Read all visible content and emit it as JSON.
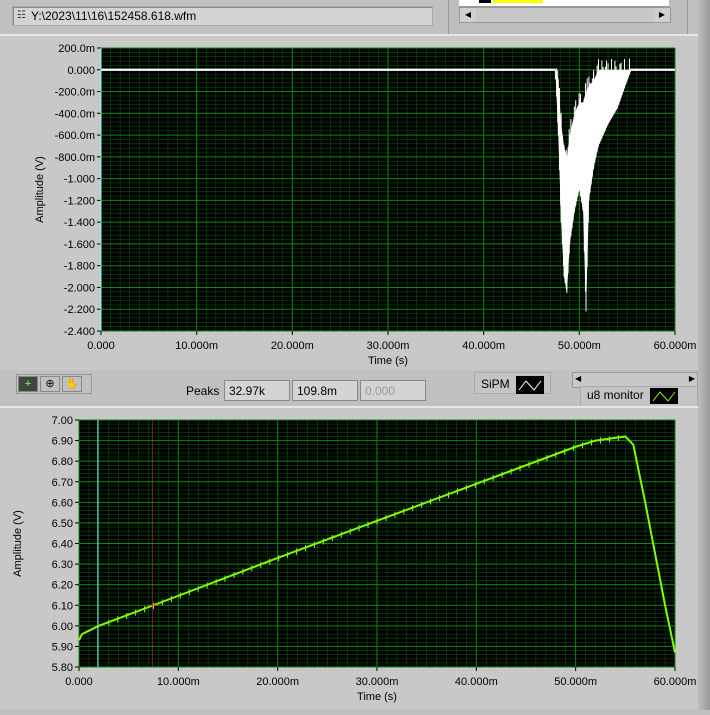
{
  "header": {
    "file_path": "Y:\\2023\\11\\16\\152458.618.wfm"
  },
  "toolbar": {
    "tools": [
      "cursor-tool",
      "zoom-tool",
      "pan-tool"
    ]
  },
  "peaks": {
    "label": "Peaks",
    "values": [
      "32.97k",
      "109.8m",
      "0.000"
    ]
  },
  "legends": {
    "sipm": "SiPM",
    "u8": "u8 monitor"
  },
  "colors": {
    "plot_bg": "#000000",
    "grid": "#0a8a0a",
    "top_trace": "#ffffff",
    "bottom_trace": "#7fff00",
    "cursor1": "#80ffff",
    "cursor2": "#ff3030"
  },
  "chart_data": [
    {
      "type": "line",
      "name": "SiPM",
      "xlabel": "Time (s)",
      "ylabel": "Amplitude (V)",
      "xlim": [
        0,
        0.06
      ],
      "ylim": [
        -2.4,
        0.2
      ],
      "xticks": [
        "0.000",
        "10.000m",
        "20.000m",
        "30.000m",
        "40.000m",
        "50.000m",
        "60.000m"
      ],
      "yticks": [
        "200.0m",
        "0.000",
        "-200.0m",
        "-400.0m",
        "-600.0m",
        "-800.0m",
        "-1.000",
        "-1.200",
        "-1.400",
        "-1.600",
        "-1.800",
        "-2.000",
        "-2.200",
        "-2.400"
      ],
      "envelope_ms": [
        [
          0,
          0.01,
          -0.01
        ],
        [
          47.5,
          0.01,
          -0.01
        ],
        [
          47.8,
          -0.1,
          -0.6
        ],
        [
          48.1,
          -0.5,
          -1.4
        ],
        [
          48.4,
          -0.7,
          -1.9
        ],
        [
          48.7,
          -0.8,
          -2.05
        ],
        [
          49.0,
          -0.6,
          -1.6
        ],
        [
          49.5,
          -0.4,
          -1.3
        ],
        [
          50.0,
          -0.3,
          -1.1
        ],
        [
          50.4,
          -0.3,
          -1.3
        ],
        [
          50.7,
          -0.2,
          -2.22
        ],
        [
          51.0,
          -0.15,
          -1.2
        ],
        [
          51.5,
          -0.1,
          -0.9
        ],
        [
          52.0,
          0.0,
          -0.7
        ],
        [
          53.0,
          0.0,
          -0.5
        ],
        [
          54.0,
          0.0,
          -0.35
        ],
        [
          55.0,
          0.0,
          -0.1
        ],
        [
          55.4,
          0.01,
          -0.01
        ],
        [
          60,
          0.01,
          -0.01
        ]
      ],
      "grid": true
    },
    {
      "type": "line",
      "name": "u8 monitor",
      "xlabel": "Time (s)",
      "ylabel": "Amplitude (V)",
      "xlim": [
        0,
        0.06
      ],
      "ylim": [
        5.8,
        7.0
      ],
      "xticks": [
        "0.000",
        "10.000m",
        "20.000m",
        "30.000m",
        "40.000m",
        "50.000m",
        "60.000m"
      ],
      "yticks": [
        "7.00",
        "6.90",
        "6.80",
        "6.70",
        "6.60",
        "6.50",
        "6.40",
        "6.30",
        "6.20",
        "6.10",
        "6.00",
        "5.90",
        "5.80"
      ],
      "points_ms": [
        [
          0,
          5.93
        ],
        [
          0.3,
          5.96
        ],
        [
          2,
          6.0
        ],
        [
          7.5,
          6.1
        ],
        [
          20,
          6.33
        ],
        [
          30,
          6.51
        ],
        [
          40,
          6.69
        ],
        [
          50,
          6.87
        ],
        [
          52,
          6.9
        ],
        [
          55,
          6.92
        ],
        [
          55.8,
          6.88
        ],
        [
          57,
          6.6
        ],
        [
          58,
          6.35
        ],
        [
          59,
          6.1
        ],
        [
          60,
          5.87
        ]
      ],
      "cursors_ms": [
        1.9,
        7.4
      ],
      "grid": true
    }
  ]
}
